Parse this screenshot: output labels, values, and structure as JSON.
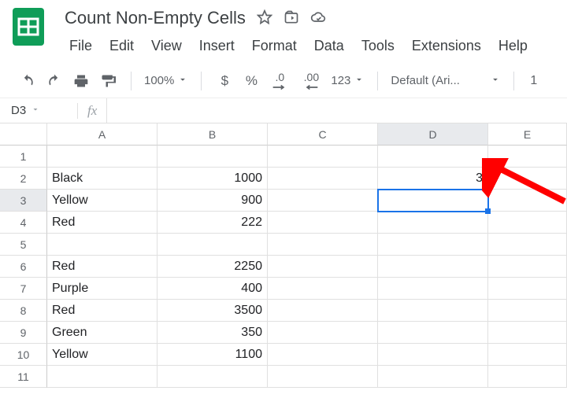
{
  "app": {
    "title": "Count Non-Empty Cells"
  },
  "menus": {
    "file": "File",
    "edit": "Edit",
    "view": "View",
    "insert": "Insert",
    "format": "Format",
    "data": "Data",
    "tools": "Tools",
    "extensions": "Extensions",
    "help": "Help"
  },
  "toolbar": {
    "zoom": "100%",
    "currency": "$",
    "percent": "%",
    "dec_less": ".0",
    "dec_more": ".00",
    "numfmt": "123",
    "font": "Default (Ari...",
    "fontsize_fragment": "1"
  },
  "fx": {
    "cell_ref": "D3",
    "fx_label": "fx",
    "formula": ""
  },
  "columns": [
    "A",
    "B",
    "C",
    "D",
    "E"
  ],
  "rows": [
    {
      "n": "1"
    },
    {
      "n": "2",
      "A": "Black",
      "B": "1000",
      "D": "3"
    },
    {
      "n": "3",
      "A": "Yellow",
      "B": "900"
    },
    {
      "n": "4",
      "A": "Red",
      "B": "222"
    },
    {
      "n": "5"
    },
    {
      "n": "6",
      "A": "Red",
      "B": "2250"
    },
    {
      "n": "7",
      "A": "Purple",
      "B": "400"
    },
    {
      "n": "8",
      "A": "Red",
      "B": "3500"
    },
    {
      "n": "9",
      "A": "Green",
      "B": "350"
    },
    {
      "n": "10",
      "A": "Yellow",
      "B": "1100"
    },
    {
      "n": "11"
    }
  ],
  "selection": {
    "active": "D3"
  },
  "annotation": {
    "arrow_target": "D2"
  }
}
